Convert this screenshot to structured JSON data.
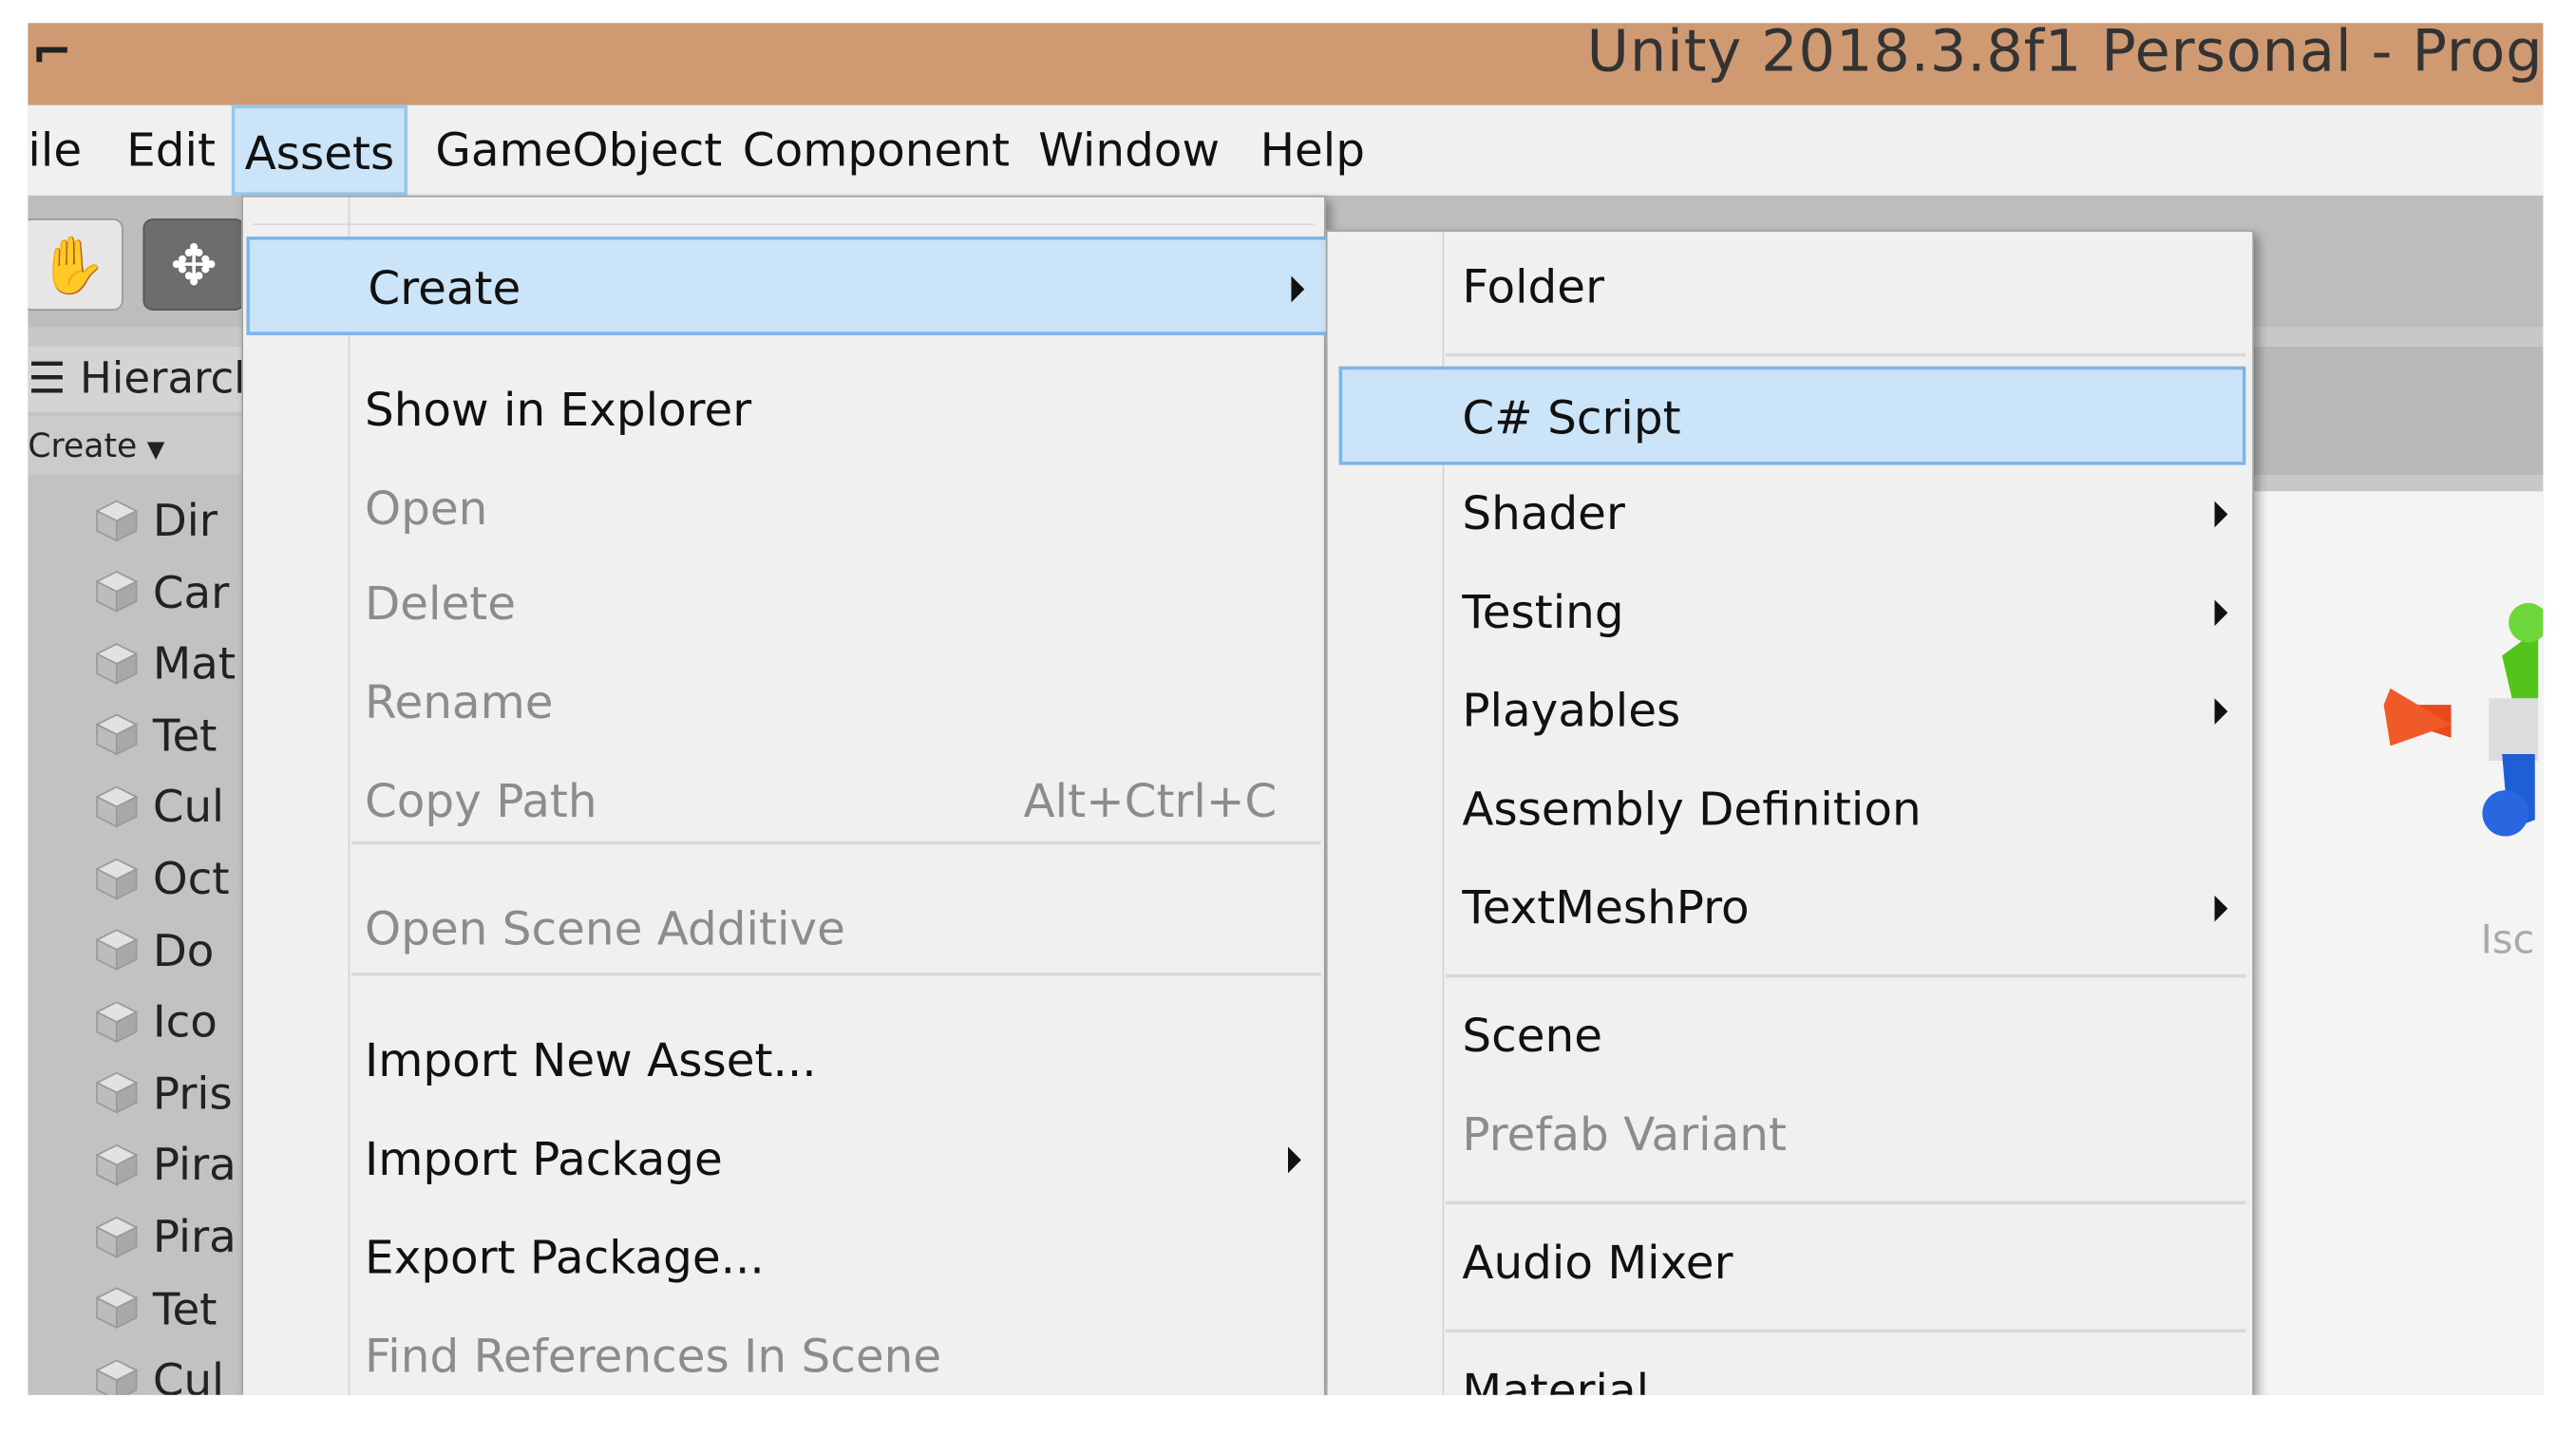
{
  "window": {
    "title": "Unity 2018.3.8f1 Personal - Prog",
    "app_icon": "unity-logo-icon"
  },
  "menubar": {
    "items": [
      {
        "label": "ile"
      },
      {
        "label": "Edit"
      },
      {
        "label": "Assets",
        "active": true
      },
      {
        "label": "GameObject"
      },
      {
        "label": "Component"
      },
      {
        "label": "Window"
      },
      {
        "label": "Help"
      }
    ]
  },
  "toolbar": {
    "hand_icon": "hand-tool-icon",
    "move_icon": "move-tool-icon"
  },
  "hierarchy": {
    "title": "Hierarch",
    "create_label": "Create",
    "items": [
      "Dir",
      "Car",
      "Mat",
      "Tet",
      "Cul",
      "Oct",
      "Do",
      "Ico",
      "Pris",
      "Pira",
      "Pira",
      "Tet",
      "Cul"
    ]
  },
  "assets_menu": {
    "items": [
      {
        "label": "Create",
        "submenu": true,
        "highlighted": true
      },
      {
        "label": "Show in Explorer"
      },
      {
        "label": "Open",
        "disabled": true
      },
      {
        "label": "Delete",
        "disabled": true
      },
      {
        "label": "Rename",
        "disabled": true
      },
      {
        "label": "Copy Path",
        "shortcut": "Alt+Ctrl+C",
        "disabled": true
      },
      {
        "label": "Open Scene Additive",
        "disabled": true
      },
      {
        "label": "Import New Asset..."
      },
      {
        "label": "Import Package",
        "submenu": true
      },
      {
        "label": "Export Package..."
      },
      {
        "label": "Find References In Scene",
        "disabled": true
      }
    ]
  },
  "create_menu": {
    "items": [
      {
        "label": "Folder"
      },
      {
        "label": "C# Script",
        "highlighted": true
      },
      {
        "label": "Shader",
        "submenu": true
      },
      {
        "label": "Testing",
        "submenu": true
      },
      {
        "label": "Playables",
        "submenu": true
      },
      {
        "label": "Assembly Definition"
      },
      {
        "label": "TextMeshPro",
        "submenu": true
      },
      {
        "label": "Scene"
      },
      {
        "label": "Prefab Variant",
        "disabled": true
      },
      {
        "label": "Audio Mixer"
      },
      {
        "label": "Material"
      }
    ]
  },
  "scene": {
    "iso_label": "Isc"
  },
  "colors": {
    "titlebar": "#cf9a72",
    "highlight": "#cce4f7",
    "highlight_border": "#7eb4ea"
  }
}
